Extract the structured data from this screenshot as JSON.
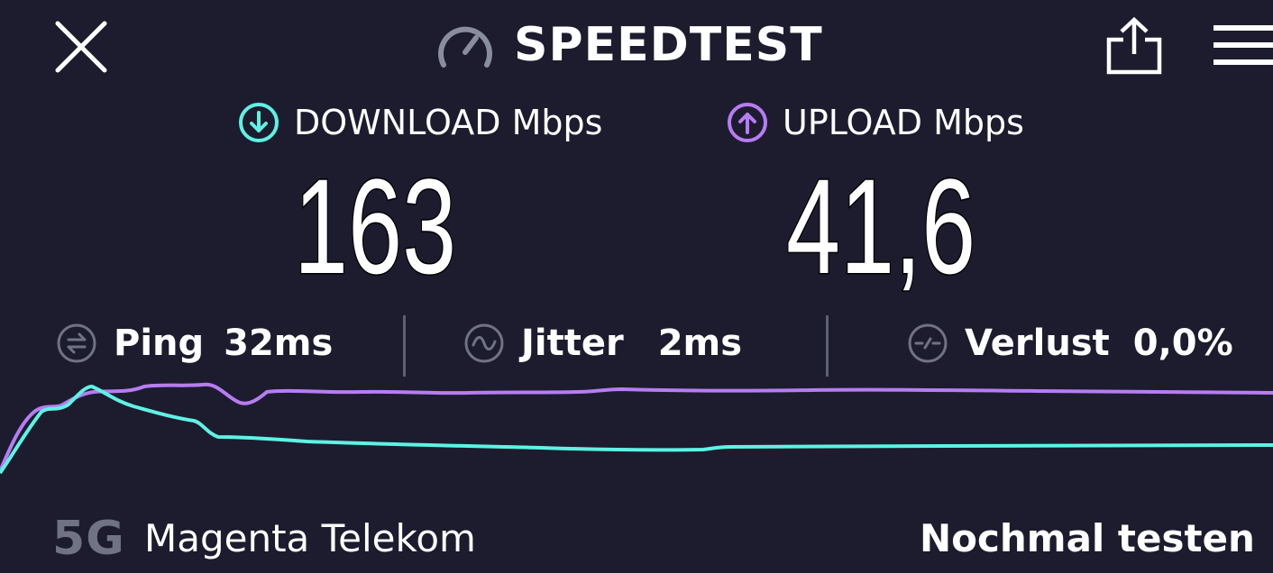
{
  "header": {
    "title": "SPEEDTEST",
    "close_icon": "close-icon",
    "logo_icon": "speedometer-icon",
    "share_icon": "share-icon",
    "menu_icon": "hamburger-menu-icon"
  },
  "metrics": {
    "download": {
      "label": "DOWNLOAD Mbps",
      "value": "163",
      "icon": "arrow-down-circle-icon",
      "color": "#5ef2e4"
    },
    "upload": {
      "label": "UPLOAD Mbps",
      "value": "41,6",
      "icon": "arrow-up-circle-icon",
      "color": "#b77cf2"
    }
  },
  "stats": {
    "ping": {
      "label": "Ping",
      "value": "32ms",
      "icon": "ping-icon"
    },
    "jitter": {
      "label": "Jitter",
      "value": "2ms",
      "icon": "jitter-icon"
    },
    "loss": {
      "label": "Verlust",
      "value": "0,0%",
      "icon": "packet-loss-icon"
    }
  },
  "graph": {
    "download_color": "#5ef2e4",
    "upload_color": "#b77cf2"
  },
  "footer": {
    "network_type": "5G",
    "carrier": "Magenta Telekom",
    "retest_label": "Nochmal testen"
  },
  "colors": {
    "background": "#1c1c2e",
    "muted": "#6f7384"
  }
}
